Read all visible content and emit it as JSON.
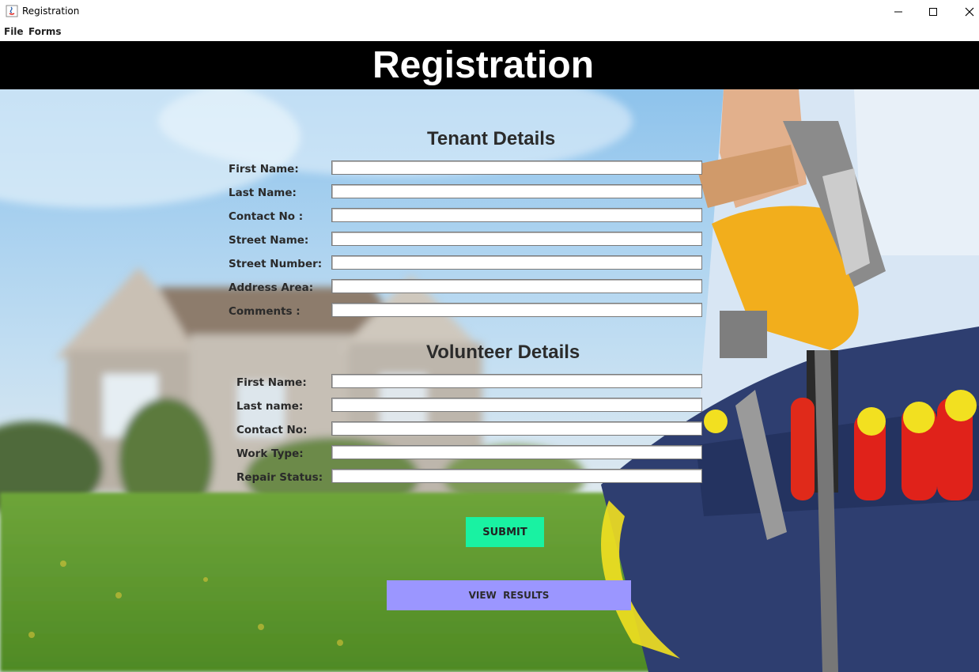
{
  "window": {
    "title": "Registration",
    "app_icon": "java-icon"
  },
  "menu": {
    "items": [
      "File",
      "Forms"
    ]
  },
  "header": {
    "title": "Registration"
  },
  "tenant": {
    "title": "Tenant Details",
    "fields": [
      {
        "label": "First Name:",
        "value": ""
      },
      {
        "label": "Last Name:",
        "value": ""
      },
      {
        "label": "Contact No :",
        "value": ""
      },
      {
        "label": "Street Name:",
        "value": ""
      },
      {
        "label": "Street Number:",
        "value": ""
      },
      {
        "label": "Address Area:",
        "value": ""
      },
      {
        "label": "Comments :",
        "value": ""
      }
    ]
  },
  "volunteer": {
    "title": "Volunteer Details",
    "fields": [
      {
        "label": "First Name:",
        "value": ""
      },
      {
        "label": "Last name:",
        "value": ""
      },
      {
        "label": "Contact No:",
        "value": ""
      },
      {
        "label": "Work Type:",
        "value": ""
      },
      {
        "label": "Repair Status:",
        "value": ""
      }
    ]
  },
  "buttons": {
    "submit": "SUBMIT",
    "view_results": "VIEW  RESULTS"
  },
  "colors": {
    "submit_bg": "#19f2a2",
    "view_results_bg": "#9b96ff",
    "header_bg": "#000000"
  }
}
